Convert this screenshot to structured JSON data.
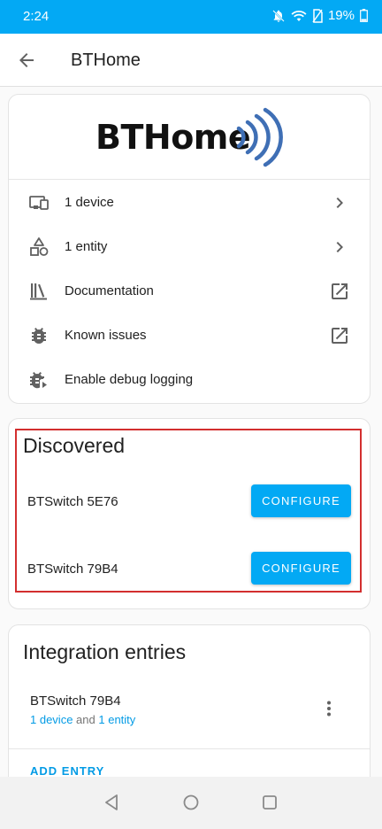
{
  "status": {
    "time": "2:24",
    "battery": "19%"
  },
  "appbar": {
    "title": "BTHome",
    "back_icon": "arrow-left-icon"
  },
  "integration": {
    "logo_text": "BTHome",
    "rows": [
      {
        "label": "1 device",
        "icon": "devices-icon",
        "trail": "chevron-right-icon"
      },
      {
        "label": "1 entity",
        "icon": "shapes-icon",
        "trail": "chevron-right-icon"
      },
      {
        "label": "Documentation",
        "icon": "book-icon",
        "trail": "open-in-new-icon"
      },
      {
        "label": "Known issues",
        "icon": "bug-icon",
        "trail": "open-in-new-icon"
      },
      {
        "label": "Enable debug logging",
        "icon": "bug-play-icon"
      }
    ]
  },
  "discovered": {
    "title": "Discovered",
    "items": [
      {
        "name": "BTSwitch 5E76",
        "button": "CONFIGURE"
      },
      {
        "name": "BTSwitch 79B4",
        "button": "CONFIGURE"
      }
    ]
  },
  "entries": {
    "title": "Integration entries",
    "items": [
      {
        "name": "BTSwitch 79B4",
        "devices_link": "1 device",
        "and": "and",
        "entities_link": "1 entity"
      }
    ],
    "add_label": "ADD ENTRY"
  },
  "colors": {
    "accent": "#03a9f4",
    "link": "#039be5",
    "highlight": "#d32f2f",
    "logo_waves": "#3f6fb5"
  }
}
